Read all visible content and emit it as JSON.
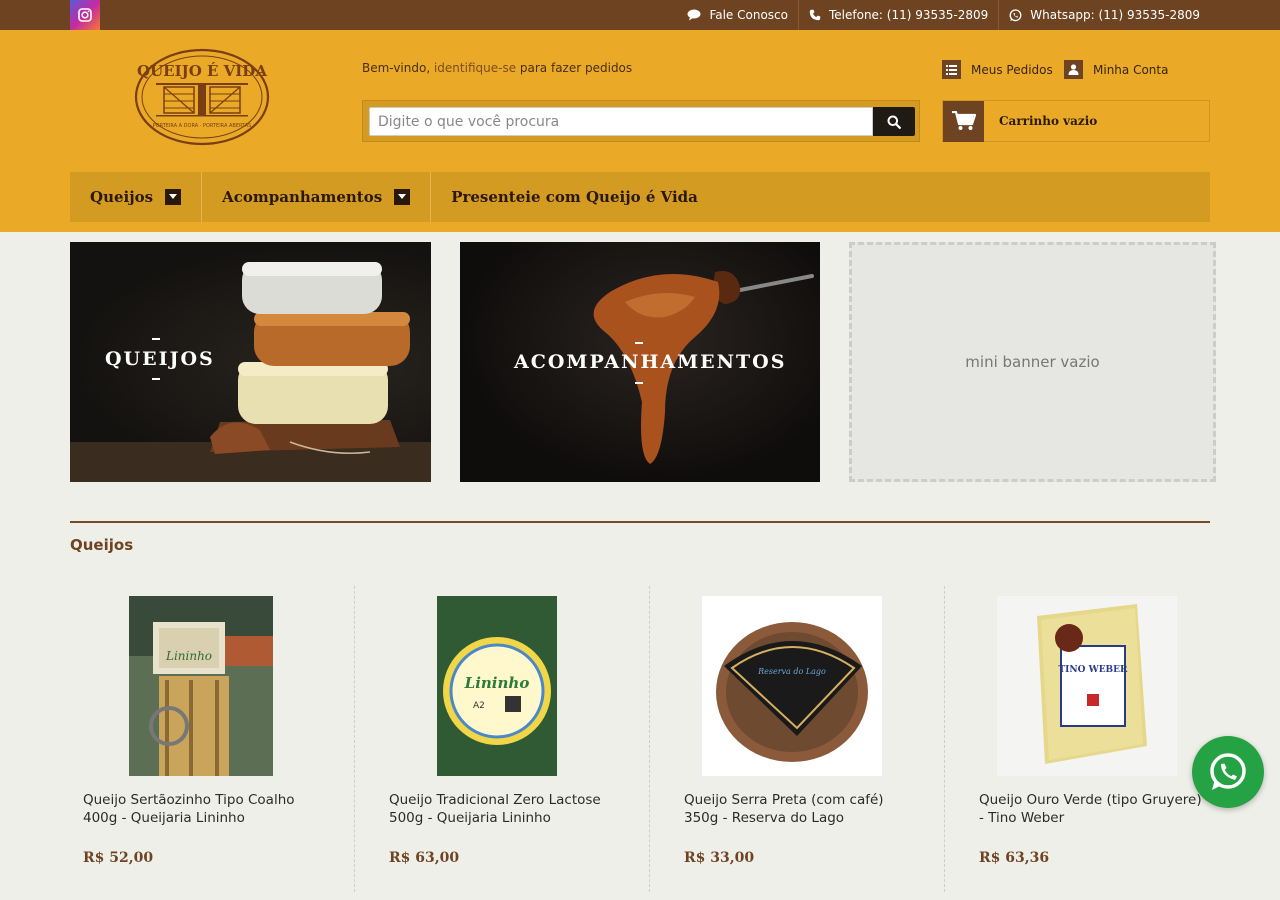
{
  "topbar": {
    "links": [
      {
        "label": "Fale Conosco",
        "icon": "chat-icon"
      },
      {
        "label": "Telefone: (11) 93535-2809",
        "icon": "phone-icon"
      },
      {
        "label": "Whatsapp: (11) 93535-2809",
        "icon": "whatsapp-icon"
      }
    ]
  },
  "header": {
    "logo_text": "QUEIJO É VIDA",
    "logo_sub": "PORTEIRA A DORA · PORTEIRA ABERTAS",
    "welcome_prefix": "Bem-vindo,",
    "welcome_link": "identifique-se",
    "welcome_suffix": "para fazer pedidos",
    "search_placeholder": "Digite o que você procura",
    "orders_label": "Meus Pedidos",
    "account_label": "Minha Conta",
    "cart_label": "Carrinho vazio"
  },
  "nav": {
    "items": [
      {
        "label": "Queijos"
      },
      {
        "label": "Acompanhamentos"
      },
      {
        "label": "Presenteie com Queijo é Vida"
      }
    ]
  },
  "banners": {
    "b1": "QUEIJOS",
    "b2": "ACOMPANHAMENTOS",
    "b3": "mini banner vazio"
  },
  "section": {
    "title": "Queijos"
  },
  "products": [
    {
      "name": "Queijo Sertãozinho Tipo Coalho 400g - Queijaria Lininho",
      "price": "R$ 52,00",
      "label_text": "Lininho"
    },
    {
      "name": "Queijo Tradicional Zero Lactose 500g - Queijaria Lininho",
      "price": "R$ 63,00",
      "label_text": "Lininho"
    },
    {
      "name": "Queijo Serra Preta (com café) 350g - Reserva do Lago",
      "price": "R$ 33,00",
      "label_text": "Reserva do Lago"
    },
    {
      "name": "Queijo Ouro Verde (tipo Gruyere) - Tino Weber",
      "price": "R$ 63,36",
      "label_text": "TINO WEBER"
    }
  ],
  "colors": {
    "topbar": "#6e4321",
    "header": "#eaaa28",
    "nav": "#d49b22",
    "price": "#6e4321",
    "whatsapp": "#25a244"
  }
}
